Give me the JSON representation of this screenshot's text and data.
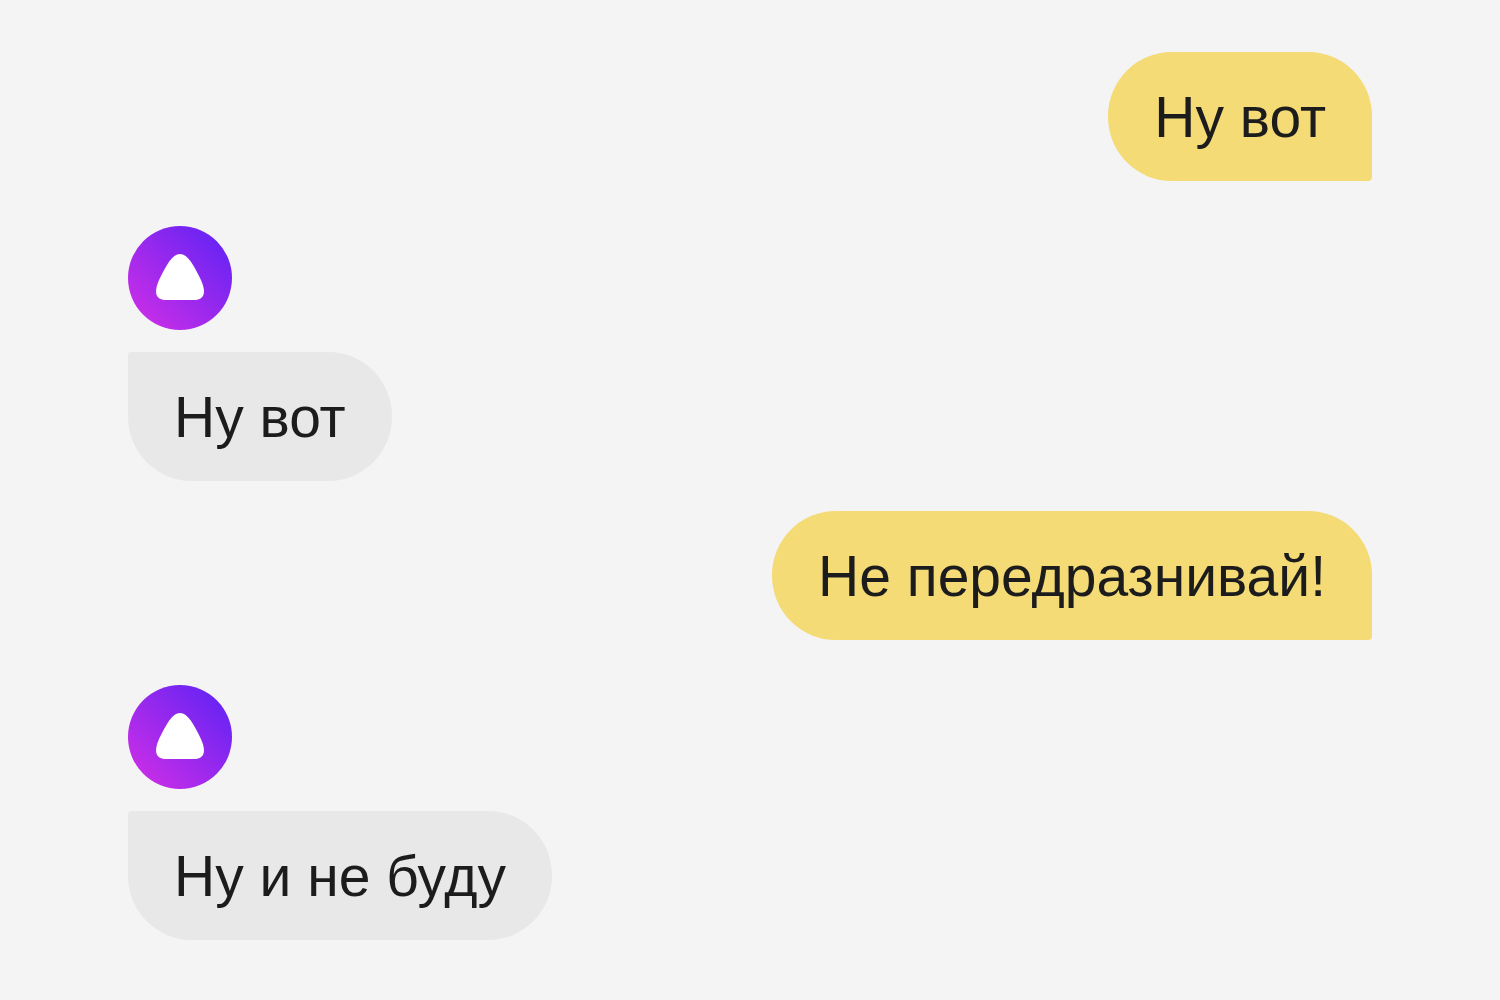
{
  "messages": [
    {
      "kind": "user",
      "text": "Ну вот"
    },
    {
      "kind": "bot",
      "text": "Ну вот"
    },
    {
      "kind": "user",
      "text": "Не передразнивай!"
    },
    {
      "kind": "bot",
      "text": "Ну и не буду"
    }
  ]
}
